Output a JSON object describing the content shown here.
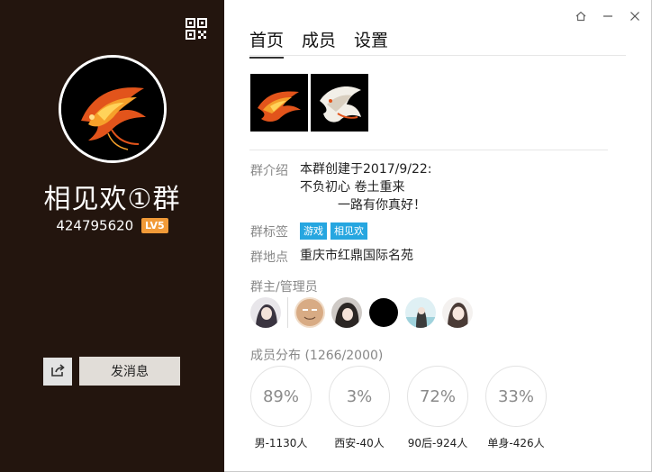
{
  "group": {
    "name": "相见欢①群",
    "id": "424795620",
    "level": "LV5"
  },
  "actions": {
    "send_message": "发消息"
  },
  "tabs": [
    {
      "label": "首页",
      "active": true
    },
    {
      "label": "成员",
      "active": false
    },
    {
      "label": "设置",
      "active": false
    }
  ],
  "info": {
    "intro_label": "群介绍",
    "intro_lines": [
      "本群创建于2017/9/22:",
      "不负初心 卷土重来",
      "一路有你真好！"
    ],
    "tags_label": "群标签",
    "tags": [
      "游戏",
      "相见欢"
    ],
    "location_label": "群地点",
    "location": "重庆市红鼎国际名苑",
    "admins_label": "群主/管理员",
    "distribution_label": "成员分布 (1266/2000)"
  },
  "stats": [
    {
      "percent": "89%",
      "label": "男-1130人"
    },
    {
      "percent": "3%",
      "label": "西安-40人"
    },
    {
      "percent": "72%",
      "label": "90后-924人"
    },
    {
      "percent": "33%",
      "label": "单身-426人"
    }
  ],
  "colors": {
    "left_panel_bg": "#23150e",
    "level_badge": "#f19a38",
    "tag_bg": "#26a6e0"
  },
  "icons": {
    "qr": "qr-code-icon",
    "share": "share-icon",
    "home": "home-icon",
    "minimize": "minimize-icon",
    "close": "close-icon"
  }
}
